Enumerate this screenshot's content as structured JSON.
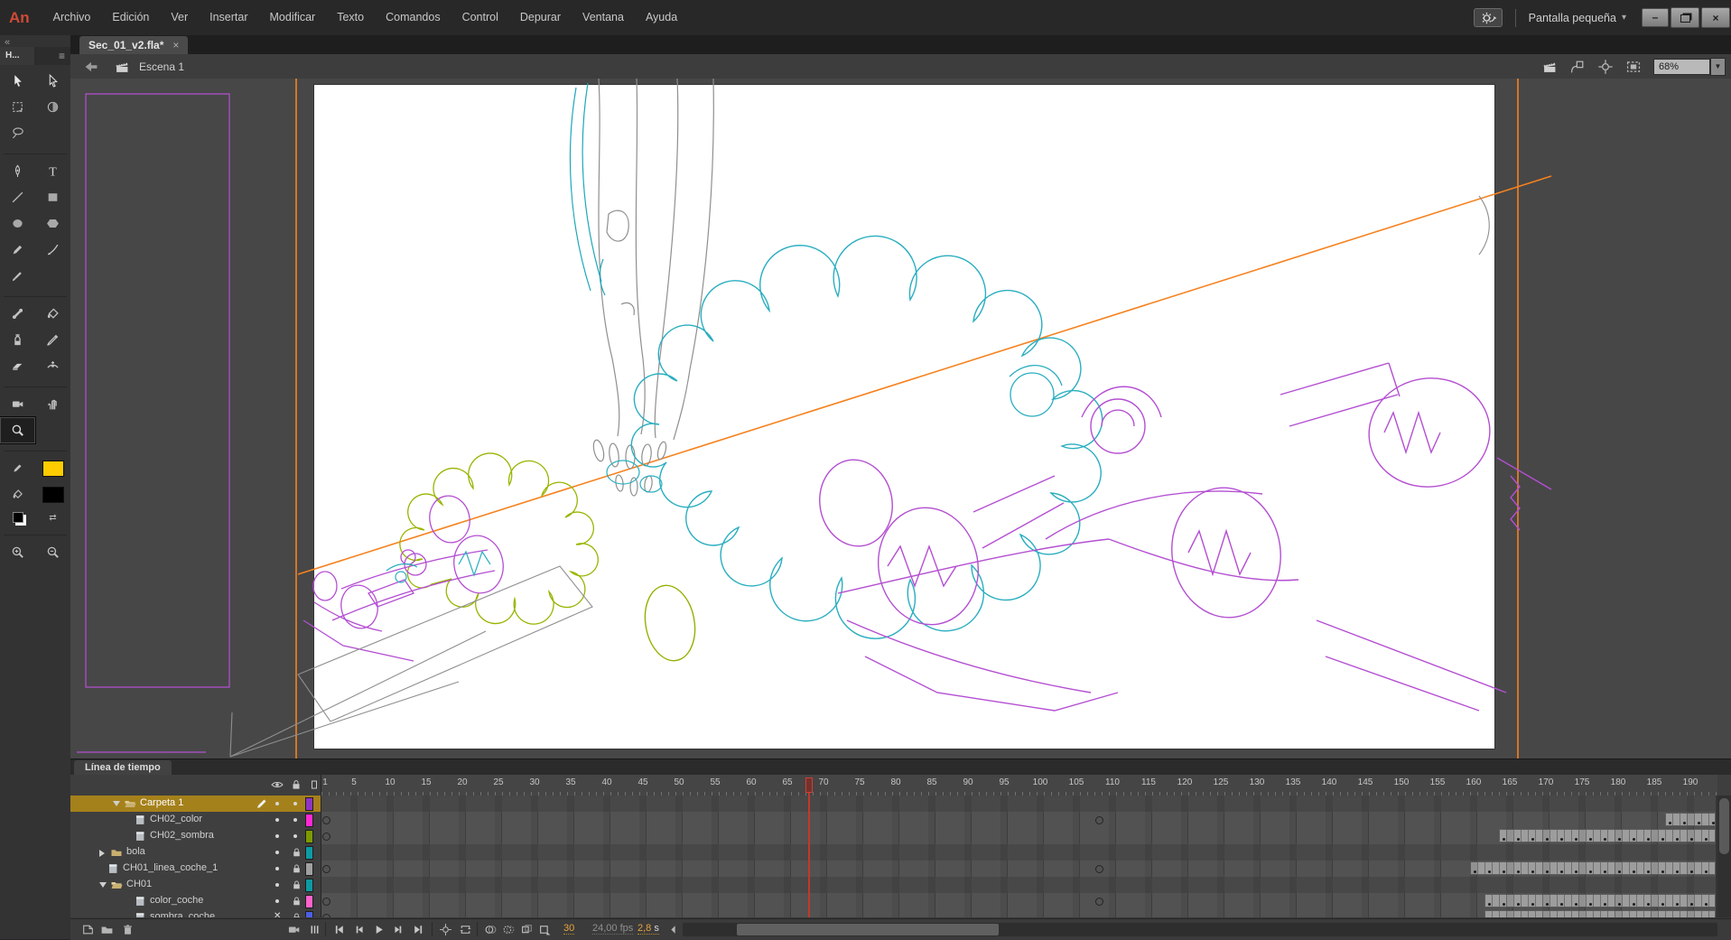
{
  "menubar": {
    "logo": "An",
    "items": [
      "Archivo",
      "Edición",
      "Ver",
      "Insertar",
      "Modificar",
      "Texto",
      "Comandos",
      "Control",
      "Depurar",
      "Ventana",
      "Ayuda"
    ],
    "workspace_switcher": "Pantalla pequeña",
    "window_controls": {
      "minimize": "–",
      "restore": "",
      "close": "×"
    }
  },
  "document_tabs": {
    "active_tab": "Sec_01_v2.fla*",
    "close_glyph": "×"
  },
  "edit_bar": {
    "scene_name": "Escena 1",
    "zoom_value": "68%",
    "zoom_caret": "▼",
    "icons": [
      "edit-scene-icon",
      "edit-symbol-icon",
      "center-stage-icon",
      "clip-outside-icon"
    ]
  },
  "tools_panel": {
    "header_tab": "H...",
    "collapse_glyph": "«",
    "menu_glyph": "≡",
    "rows": [
      [
        "selection-tool",
        "subselection-tool"
      ],
      [
        "free-transform-tool",
        "gradient-transform-tool"
      ],
      [
        "lasso-tool",
        null
      ],
      "div",
      [
        "pen-tool",
        "text-tool"
      ],
      [
        "line-tool",
        "rectangle-tool"
      ],
      [
        "oval-tool",
        "polystar-tool"
      ],
      [
        "pencil-tool",
        "art-brush-tool"
      ],
      [
        "paint-brush-tool",
        null
      ],
      "div",
      [
        "bone-tool",
        "paint-bucket-tool"
      ],
      [
        "ink-bottle-tool",
        "eyedropper-tool"
      ],
      [
        "eraser-tool",
        "width-tool"
      ],
      "div",
      [
        "camera-tool",
        "hand-tool"
      ],
      [
        "zoom-tool",
        null
      ],
      "div"
    ],
    "selected_tool": "zoom-tool",
    "stroke_color": "#ffcc00",
    "fill_color": "#000000"
  },
  "stage": {
    "colors": {
      "pasteboard": "#474747",
      "stage": "#ffffff",
      "guide_orange": "#f5821f",
      "outline_purple": "#b44fd2",
      "outline_cyan": "#2aaec0",
      "outline_green": "#93b000",
      "outline_gray": "#8f8f8f"
    }
  },
  "timeline": {
    "panel_tab": "Línea de tiempo",
    "ruler": {
      "start": 1,
      "end": 193,
      "label_step": 5,
      "playhead_frame": 68
    },
    "layers": [
      {
        "name": "Carpeta 1",
        "kind": "folder",
        "expanded": true,
        "indent": 2,
        "selected": true,
        "edit_pencil": true,
        "vis": "dot",
        "lock": "dot",
        "color": "#8f35c4",
        "row": "plain",
        "keyframes": [],
        "cluster": null
      },
      {
        "name": "CH02_color",
        "kind": "layer",
        "indent": 3,
        "selected": false,
        "vis": "dot",
        "lock": "dot",
        "color": "#ff29d4",
        "row": "content",
        "keyframes": [
          1,
          108
        ],
        "cluster": [
          187,
          193
        ]
      },
      {
        "name": "CH02_sombra",
        "kind": "layer",
        "indent": 3,
        "selected": false,
        "vis": "dot",
        "lock": "dot",
        "color": "#7c9a00",
        "row": "content",
        "keyframes": [
          1
        ],
        "cluster": [
          164,
          193
        ]
      },
      {
        "name": "bola",
        "kind": "folder",
        "expanded": false,
        "indent": 1,
        "selected": false,
        "vis": "dot",
        "lock": "lock",
        "color": "#0d9aa2",
        "row": "plain",
        "keyframes": [],
        "cluster": null
      },
      {
        "name": "CH01_linea_coche_1",
        "kind": "layer",
        "indent": 1,
        "selected": false,
        "vis": "dot",
        "lock": "lock",
        "color": "#a0a0a0",
        "row": "content",
        "keyframes": [
          1,
          108
        ],
        "cluster": [
          160,
          193
        ]
      },
      {
        "name": "CH01",
        "kind": "folder",
        "expanded": true,
        "indent": 1,
        "selected": false,
        "vis": "dot",
        "lock": "lock",
        "color": "#0d9aa2",
        "row": "plain",
        "keyframes": [],
        "cluster": null
      },
      {
        "name": "color_coche",
        "kind": "layer",
        "indent": 3,
        "selected": false,
        "vis": "dot",
        "lock": "lock",
        "color": "#ff63cc",
        "row": "content",
        "keyframes": [
          1,
          108
        ],
        "cluster": [
          162,
          193
        ]
      },
      {
        "name": "sombra_coche",
        "kind": "layer",
        "indent": 3,
        "selected": false,
        "vis": "x",
        "lock": "lock",
        "color": "#4a5fe4",
        "row": "content",
        "keyframes": [
          1
        ],
        "cluster": [
          162,
          193
        ]
      }
    ],
    "status_bar": {
      "current_frame": "30",
      "frame_rate": "24,00 fps",
      "elapsed_time_value": "2,8",
      "elapsed_time_unit": "s"
    }
  }
}
